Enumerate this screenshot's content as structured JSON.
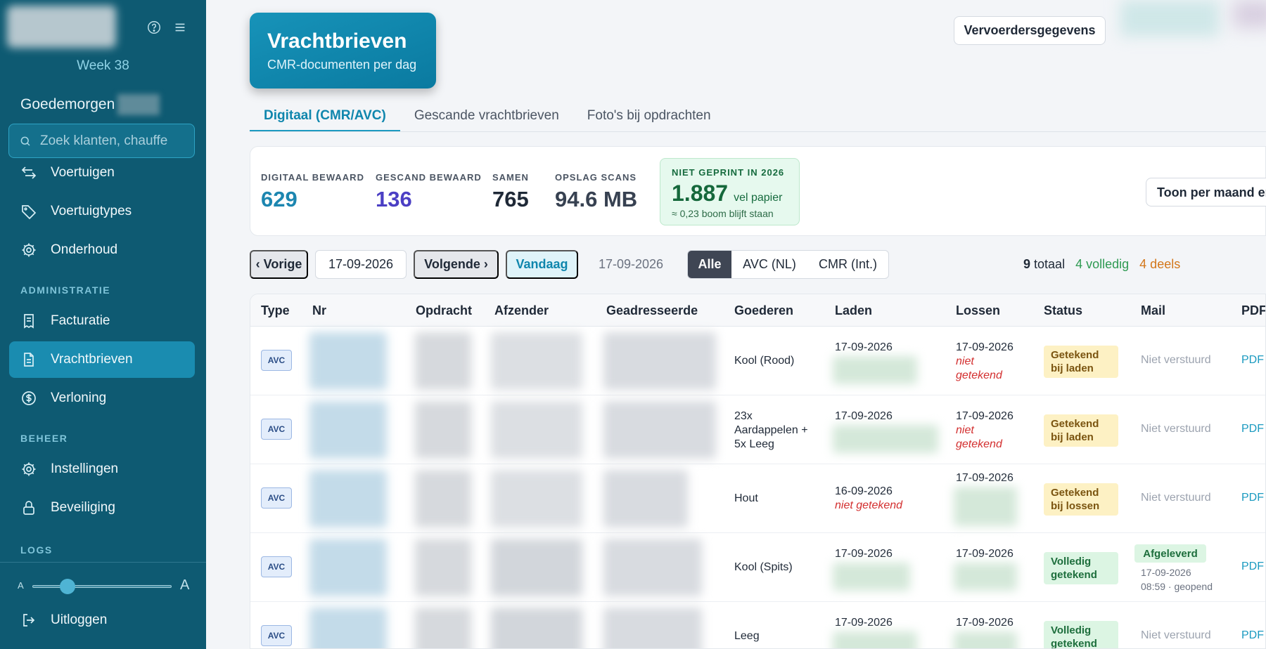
{
  "sidebar": {
    "week": "Week 38",
    "greeting": "Goedemorgen",
    "search_placeholder": "Zoek klanten, chauffe",
    "items": [
      {
        "label": "Voertuigen"
      },
      {
        "label": "Voertuigtypes"
      },
      {
        "label": "Onderhoud"
      },
      {
        "label": "Facturatie"
      },
      {
        "label": "Vrachtbrieven"
      },
      {
        "label": "Verloning"
      },
      {
        "label": "Instellingen"
      },
      {
        "label": "Beveiliging"
      }
    ],
    "sections": {
      "administratie": "ADMINISTRATIE",
      "beheer": "BEHEER",
      "logs": "LOGS"
    },
    "font_small": "A",
    "font_large": "A",
    "font_scale": 0.25,
    "logout": "Uitloggen"
  },
  "header": {
    "title": "Vrachtbrieven",
    "subtitle": "CMR-documenten per dag",
    "carrier_button": "Vervoerdersgegevens"
  },
  "tabs": [
    {
      "label": "Digitaal (CMR/AVC)",
      "active": true
    },
    {
      "label": "Gescande vrachtbrieven",
      "active": false
    },
    {
      "label": "Foto's bij opdrachten",
      "active": false
    }
  ],
  "stats": {
    "digital": {
      "label": "DIGITAAL BEWAARD",
      "value": "629"
    },
    "scanned": {
      "label": "GESCAND BEWAARD",
      "value": "136"
    },
    "total": {
      "label": "SAMEN",
      "value": "765"
    },
    "storage": {
      "label": "OPSLAG SCANS",
      "value": "94.6 MB"
    },
    "not_printed": {
      "label": "NIET GEPRINT IN 2026",
      "value": "1.887",
      "unit": "vel papier",
      "note": "≈ 0,23 boom blijft staan"
    },
    "month_button": "Toon per maand en"
  },
  "toolbar": {
    "prev": "‹ Vorige",
    "date_value": "17-09-2026",
    "next": "Volgende ›",
    "today": "Vandaag",
    "date_display": "17-09-2026",
    "filters": [
      {
        "label": "Alle",
        "active": true
      },
      {
        "label": "AVC (NL)",
        "active": false
      },
      {
        "label": "CMR (Int.)",
        "active": false
      }
    ],
    "count_total_num": "9",
    "count_total_label": "totaal",
    "count_complete": "4 volledig",
    "count_partial": "4 deels"
  },
  "table": {
    "columns": [
      "Type",
      "Nr",
      "Opdracht",
      "Afzender",
      "Geadresseerde",
      "Goederen",
      "Laden",
      "Lossen",
      "Status",
      "Mail",
      "PDF"
    ],
    "rows": [
      {
        "type": "AVC",
        "goods": "Kool (Rood)",
        "load_date": "17-09-2026",
        "load_note": "",
        "unload_date": "17-09-2026",
        "unload_note": "niet getekend",
        "status": "Getekend bij laden",
        "mail": "Niet verstuurd",
        "pdf": "PDF"
      },
      {
        "type": "AVC",
        "goods": "23x Aardappelen + 5x Leeg",
        "load_date": "17-09-2026",
        "load_note": "",
        "unload_date": "17-09-2026",
        "unload_note": "niet getekend",
        "status": "Getekend bij laden",
        "mail": "Niet verstuurd",
        "pdf": "PDF"
      },
      {
        "type": "AVC",
        "goods": "Hout",
        "load_date": "16-09-2026",
        "load_note": "niet getekend",
        "unload_date": "17-09-2026",
        "unload_note": "",
        "status": "Getekend bij lossen",
        "mail": "Niet verstuurd",
        "pdf": "PDF"
      },
      {
        "type": "AVC",
        "goods": "Kool (Spits)",
        "load_date": "17-09-2026",
        "load_note": "",
        "unload_date": "17-09-2026",
        "unload_note": "",
        "status": "Volledig getekend",
        "mail_badge": "Afgeleverd",
        "mail_date": "17-09-2026",
        "mail_time": "08:59 · geopend",
        "pdf": "PDF"
      },
      {
        "type": "AVC",
        "goods": "Leeg",
        "load_date": "17-09-2026",
        "load_note": "",
        "unload_date": "17-09-2026",
        "unload_note": "",
        "status": "Volledig getekend",
        "mail": "Niet verstuurd",
        "pdf": "PDF"
      }
    ]
  },
  "colors": {
    "sidebar_bg": "#0e5a72",
    "accent": "#1a8cb0",
    "digital": "#1c86b0",
    "scanned": "#4b3fc4",
    "complete": "#2e9a52",
    "partial": "#d3771a"
  }
}
